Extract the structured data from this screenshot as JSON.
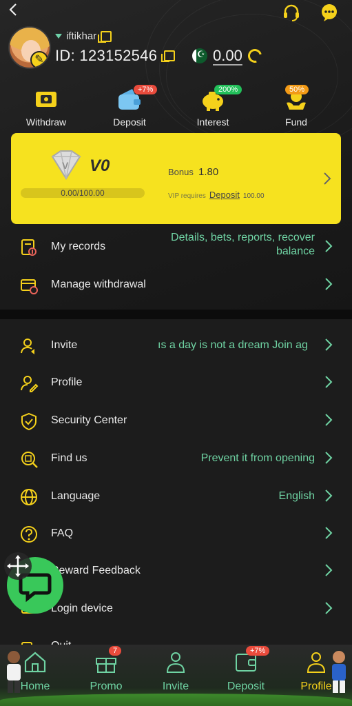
{
  "header": {
    "back_icon": "back-arrow-icon",
    "support_icon": "headset-icon",
    "message_icon": "chat-bubble-icon"
  },
  "user": {
    "name": "iftikhar",
    "id": "ID: 123152546",
    "balance": "0.00"
  },
  "quick_actions": [
    {
      "label": "Withdraw",
      "icon": "withdraw-ticket-icon",
      "badge": ""
    },
    {
      "label": "Deposit",
      "icon": "wallet-icon",
      "badge": "+7%"
    },
    {
      "label": "Interest",
      "icon": "piggy-bank-icon",
      "badge": "200%"
    },
    {
      "label": "Fund",
      "icon": "hand-coin-icon",
      "badge": "50%"
    }
  ],
  "vip": {
    "level": "V0",
    "progress_text": "0.00/100.00",
    "progress": 0.0,
    "bonus_label": "Bonus",
    "bonus_value": "1.80",
    "requires_label": "VIP requires",
    "requires_link": "Deposit",
    "requires_amount": "100.00"
  },
  "menu_top": [
    {
      "label": "My records",
      "value_line1": "Details, bets, reports, recover",
      "value_line2": "balance",
      "icon": "records-icon"
    },
    {
      "label": "Manage withdrawal",
      "value": "",
      "icon": "card-settings-icon"
    }
  ],
  "menu": [
    {
      "label": "Invite",
      "value": "ıs a day is not a dream  Join ag",
      "icon": "invite-user-icon"
    },
    {
      "label": "Profile",
      "value": "",
      "icon": "user-edit-icon"
    },
    {
      "label": "Security Center",
      "value": "",
      "icon": "shield-check-icon"
    },
    {
      "label": "Find us",
      "value": "Prevent it from opening",
      "icon": "find-us-icon"
    },
    {
      "label": "Language",
      "value": "English",
      "icon": "globe-icon"
    },
    {
      "label": "FAQ",
      "value": "",
      "icon": "question-icon"
    },
    {
      "label": "Reward Feedback",
      "value": "",
      "icon": "feedback-icon"
    },
    {
      "label": "Login device",
      "value": "",
      "icon": "device-icon"
    },
    {
      "label": "Quit",
      "value": "",
      "icon": "quit-icon"
    }
  ],
  "tabs": [
    {
      "label": "Home",
      "icon": "home-icon",
      "badge": ""
    },
    {
      "label": "Promo",
      "icon": "gift-icon",
      "badge": "7"
    },
    {
      "label": "Invite",
      "icon": "group-icon",
      "badge": ""
    },
    {
      "label": "Deposit",
      "icon": "wallet-icon",
      "badge": "+7%"
    },
    {
      "label": "Profile",
      "icon": "profile-icon",
      "badge": ""
    }
  ],
  "colors": {
    "accent": "#f5d11b",
    "value_text": "#6fd3a3",
    "background": "#1c1c1c",
    "badge_red": "#e94b3c"
  }
}
